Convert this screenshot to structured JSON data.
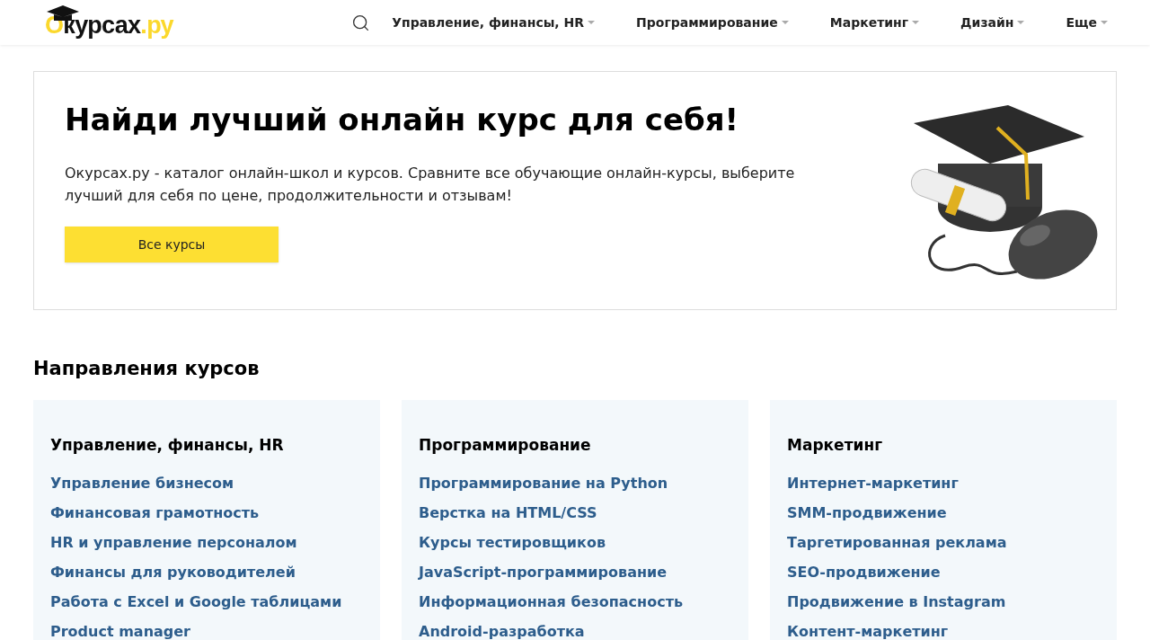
{
  "logo": {
    "parts": [
      {
        "text": "О",
        "accent": true
      },
      {
        "text": "курсах",
        "accent": false
      },
      {
        "text": ".ру",
        "accent": true
      }
    ]
  },
  "nav": [
    {
      "label": "Управление, финансы, HR"
    },
    {
      "label": "Программирование"
    },
    {
      "label": "Маркетинг"
    },
    {
      "label": "Дизайн"
    },
    {
      "label": "Еще"
    }
  ],
  "hero": {
    "title": "Найди лучший онлайн курс для себя!",
    "text": "Окурсах.ру - каталог онлайн-школ и курсов. Сравните все обучающие онлайн-курсы, выберите лучший для себя по цене, продолжительности и отзывам!",
    "button": "Все курсы"
  },
  "section_title": "Направления курсов",
  "categories": [
    {
      "title": "Управление, финансы, HR",
      "links": [
        "Управление бизнесом",
        "Финансовая грамотность",
        "HR и управление персоналом",
        "Финансы для руководителей",
        "Работа с Excel и Google таблицами",
        "Product manager"
      ]
    },
    {
      "title": "Программирование",
      "links": [
        "Программирование на Python",
        "Верстка на HTML/CSS",
        "Курсы тестировщиков",
        "JavaScript-программирование",
        "Информационная безопасность",
        "Android-разработка"
      ]
    },
    {
      "title": "Маркетинг",
      "links": [
        "Интернет-маркетинг",
        "SMM-продвижение",
        "Таргетированная реклама",
        "SEO-продвижение",
        "Продвижение в Instagram",
        "Контент-маркетинг"
      ]
    }
  ]
}
